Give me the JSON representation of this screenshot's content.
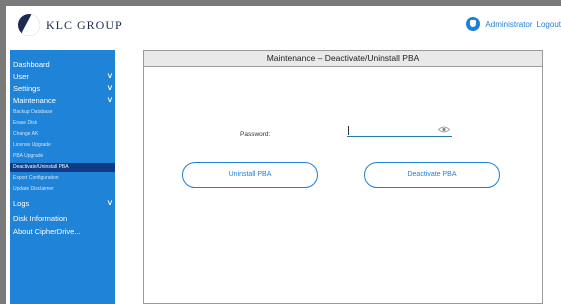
{
  "header": {
    "logo_text": "KLC GROUP",
    "user_name": "Administrator",
    "logout_label": "Logout"
  },
  "sidebar": {
    "items": [
      {
        "label": "Dashboard",
        "type": "main",
        "chevron": false
      },
      {
        "label": "User",
        "type": "main",
        "chevron": true
      },
      {
        "label": "Settings",
        "type": "main",
        "chevron": true
      },
      {
        "label": "Maintenance",
        "type": "main",
        "chevron": true
      },
      {
        "label": "Backup Database",
        "type": "sub"
      },
      {
        "label": "Erase Disk",
        "type": "sub"
      },
      {
        "label": "Change AK",
        "type": "sub"
      },
      {
        "label": "License Upgrade",
        "type": "sub"
      },
      {
        "label": "PBA Upgrade",
        "type": "sub"
      },
      {
        "label": "Deactivate/Uninstall PBA",
        "type": "sub",
        "active": true
      },
      {
        "label": "Export Configuration",
        "type": "sub"
      },
      {
        "label": "Update Disclaimer",
        "type": "sub"
      },
      {
        "label": "Logs",
        "type": "main",
        "chevron": true
      },
      {
        "label": "Disk Information",
        "type": "main",
        "chevron": false
      },
      {
        "label": "About CipherDrive...",
        "type": "main",
        "chevron": false
      }
    ]
  },
  "main": {
    "title": "Maintenance – Deactivate/Uninstall PBA",
    "password_label": "Password:",
    "password_value": "",
    "uninstall_label": "Uninstall PBA",
    "deactivate_label": "Deactivate PBA"
  },
  "colors": {
    "accent": "#1f7fd6",
    "sidebar": "#1f83d8",
    "sidebar_active": "#0e3a86",
    "brand": "#1d2a52"
  },
  "icons": {
    "logo": "klc-logo-icon",
    "admin": "user-shield-icon",
    "chevron": "chevron-down-icon",
    "eye": "eye-icon"
  }
}
